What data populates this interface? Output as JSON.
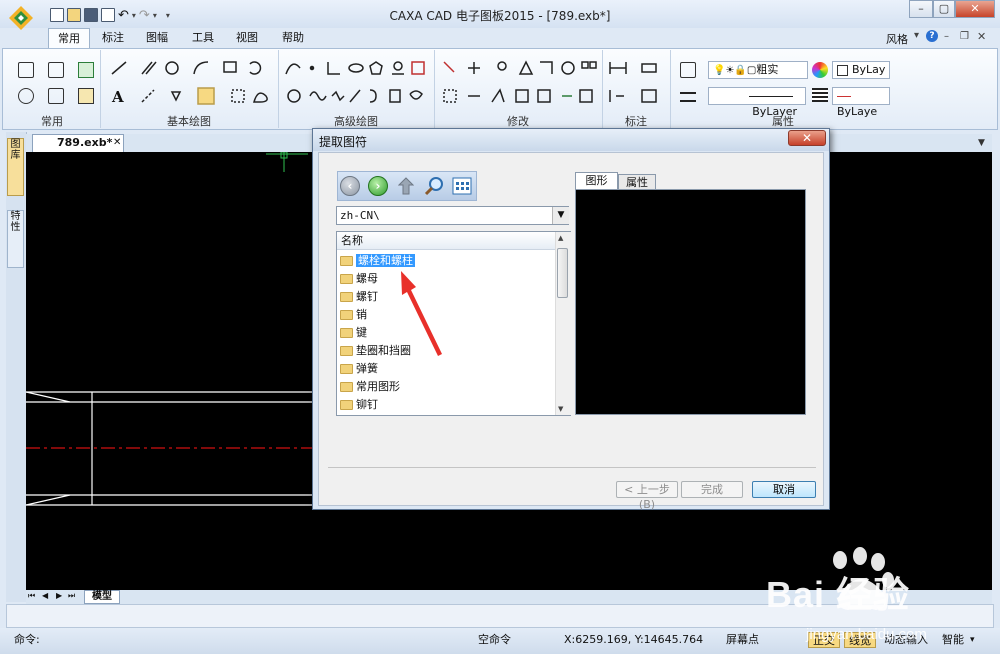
{
  "window": {
    "title": "CAXA CAD 电子图板2015 - [789.exb*]",
    "controls": [
      "–",
      "▢",
      "✕"
    ]
  },
  "ribbon": {
    "tabs": [
      "常用",
      "标注",
      "图幅",
      "工具",
      "视图",
      "帮助"
    ],
    "active_tab": "常用",
    "style_label": "风格",
    "groups": [
      "常用",
      "基本绘图",
      "高级绘图",
      "修改",
      "标注",
      "属性"
    ],
    "properties": {
      "linetype_label": "粗实",
      "color_combo": "ByLay",
      "linewidth_combo": "ByLayer",
      "linetype_combo": "ByLaye"
    }
  },
  "left_panel": {
    "tabs": [
      "图库",
      "特性"
    ]
  },
  "document": {
    "tab_label": "789.exb*",
    "sheet_tab": "模型",
    "nav_buttons": [
      "⏮",
      "◀",
      "▶",
      "⏭"
    ]
  },
  "dialog": {
    "title": "提取图符",
    "close_label": "✕",
    "path": "zh-CN\\",
    "list_header": "名称",
    "items": [
      {
        "label": "螺栓和螺柱",
        "selected": true
      },
      {
        "label": "螺母",
        "selected": false
      },
      {
        "label": "螺钉",
        "selected": false
      },
      {
        "label": "销",
        "selected": false
      },
      {
        "label": "键",
        "selected": false
      },
      {
        "label": "垫圈和挡圈",
        "selected": false
      },
      {
        "label": "弹簧",
        "selected": false
      },
      {
        "label": "常用图形",
        "selected": false
      },
      {
        "label": "铆钉",
        "selected": false
      }
    ],
    "preview_tabs": [
      "图形",
      "属性"
    ],
    "active_preview_tab": "图形",
    "buttons": {
      "prev": "< 上一步(B)",
      "finish": "完成",
      "cancel": "取消"
    }
  },
  "statusbar": {
    "command_label": "命令:",
    "command_state": "空命令",
    "coordinates": "X:6259.169, Y:14645.764",
    "snap_mode": "屏幕点",
    "ortho": "正交",
    "lineweight": "线宽",
    "dynamic_input": "动态输入",
    "smart": "智能"
  },
  "watermark": {
    "brand": "Bai  经验",
    "url": "jingyan.baidu.com"
  },
  "colors": {
    "canvas": "#000000",
    "selection": "#3399ff",
    "annotation_arrow": "#e8302a",
    "centerline": "#d01010"
  }
}
